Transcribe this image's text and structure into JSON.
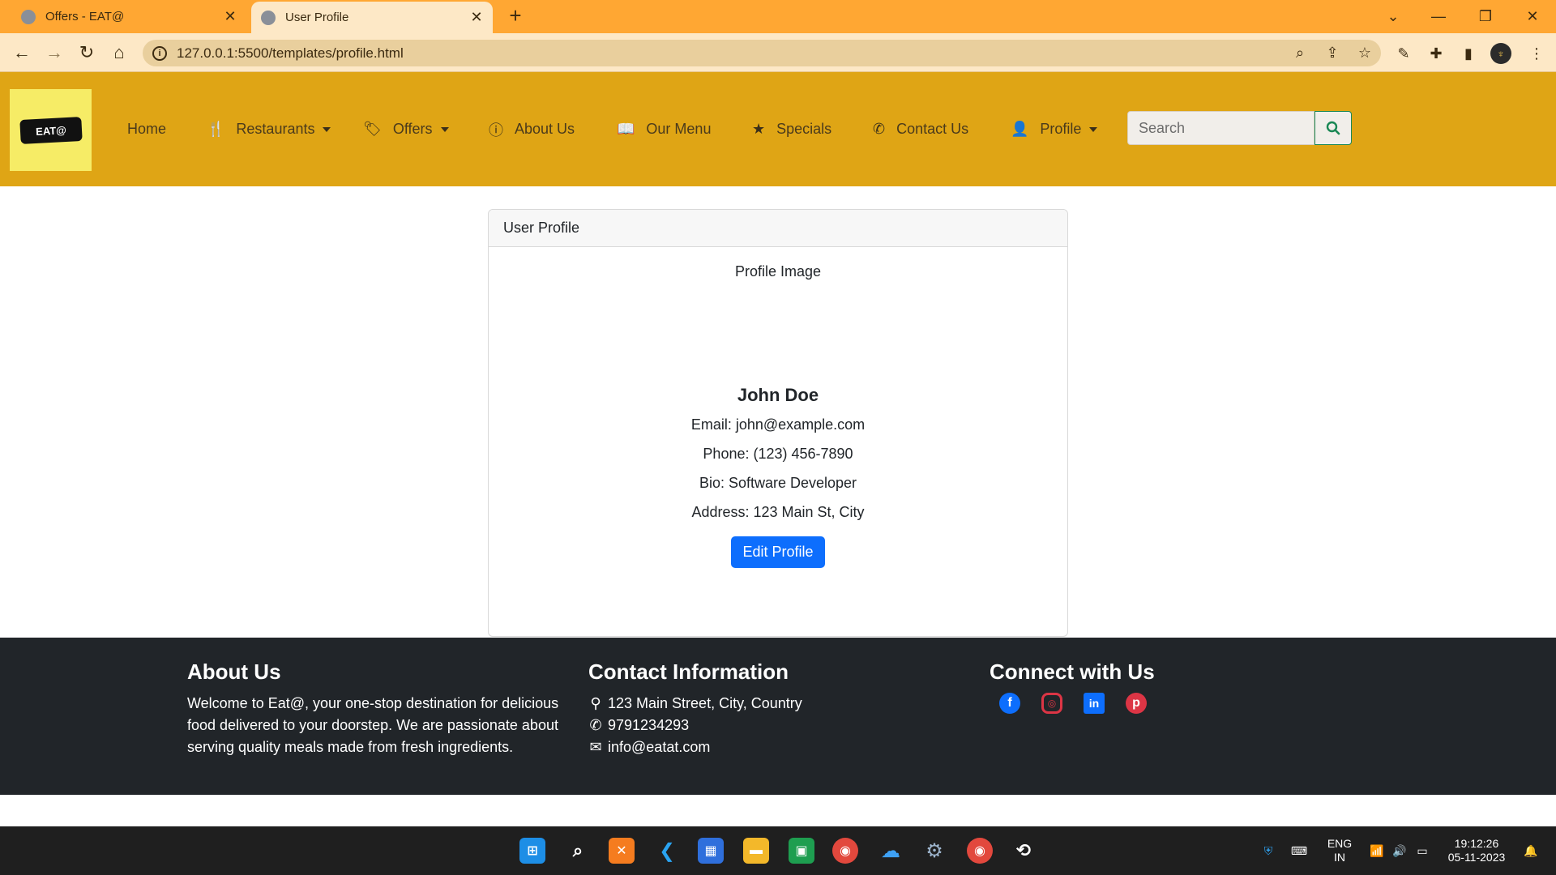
{
  "browser": {
    "tabs": [
      {
        "title": "Offers - EAT@",
        "active": false
      },
      {
        "title": "User Profile",
        "active": true
      }
    ],
    "new_tab_symbol": "+",
    "url": "127.0.0.1:5500/templates/profile.html",
    "window_controls": [
      "chevron-down-icon",
      "minimize-icon",
      "restore-icon",
      "close-icon"
    ]
  },
  "navbar": {
    "logo_text": "EAT@",
    "links": [
      {
        "label": "Home",
        "icon": "",
        "dropdown": false
      },
      {
        "label": "Restaurants",
        "icon": "utensils-icon",
        "dropdown": true
      },
      {
        "label": "Offers",
        "icon": "tags-icon",
        "dropdown": true
      },
      {
        "label": "About Us",
        "icon": "info-circle-icon",
        "dropdown": false
      },
      {
        "label": "Our Menu",
        "icon": "book-open-icon",
        "dropdown": false
      },
      {
        "label": "Specials",
        "icon": "star-icon",
        "dropdown": false
      },
      {
        "label": "Contact Us",
        "icon": "phone-icon",
        "dropdown": false
      },
      {
        "label": "Profile",
        "icon": "user-icon",
        "dropdown": true
      }
    ],
    "search": {
      "placeholder": "Search",
      "value": ""
    }
  },
  "profile_card": {
    "header": "User Profile",
    "image_alt": "Profile Image",
    "name": "John Doe",
    "email": "Email: john@example.com",
    "phone": "Phone: (123) 456-7890",
    "bio": "Bio: Software Developer",
    "address": "Address: 123 Main St, City",
    "edit_button": "Edit Profile"
  },
  "footer": {
    "about": {
      "title": "About Us",
      "text": "Welcome to Eat@, your one-stop destination for delicious food delivered to your doorstep. We are passionate about serving quality meals made from fresh ingredients."
    },
    "contact": {
      "title": "Contact Information",
      "address": "123 Main Street, City, Country",
      "phone": "9791234293",
      "email": "info@eatat.com"
    },
    "connect": {
      "title": "Connect with Us",
      "networks": [
        {
          "name": "facebook-icon",
          "color": "#0d6efd"
        },
        {
          "name": "instagram-icon",
          "color": "#dc3545"
        },
        {
          "name": "linkedin-icon",
          "color": "#0d6efd"
        },
        {
          "name": "pinterest-icon",
          "color": "#dc3545"
        }
      ]
    }
  },
  "taskbar": {
    "language": "ENG",
    "region": "IN",
    "time": "19:12:26",
    "date": "05-11-2023"
  },
  "colors": {
    "tabbar": "#ffa733",
    "navbar": "#dfa515",
    "logo_bg": "#f6ec66",
    "primary_button": "#0d6efd",
    "footer": "#212529"
  }
}
